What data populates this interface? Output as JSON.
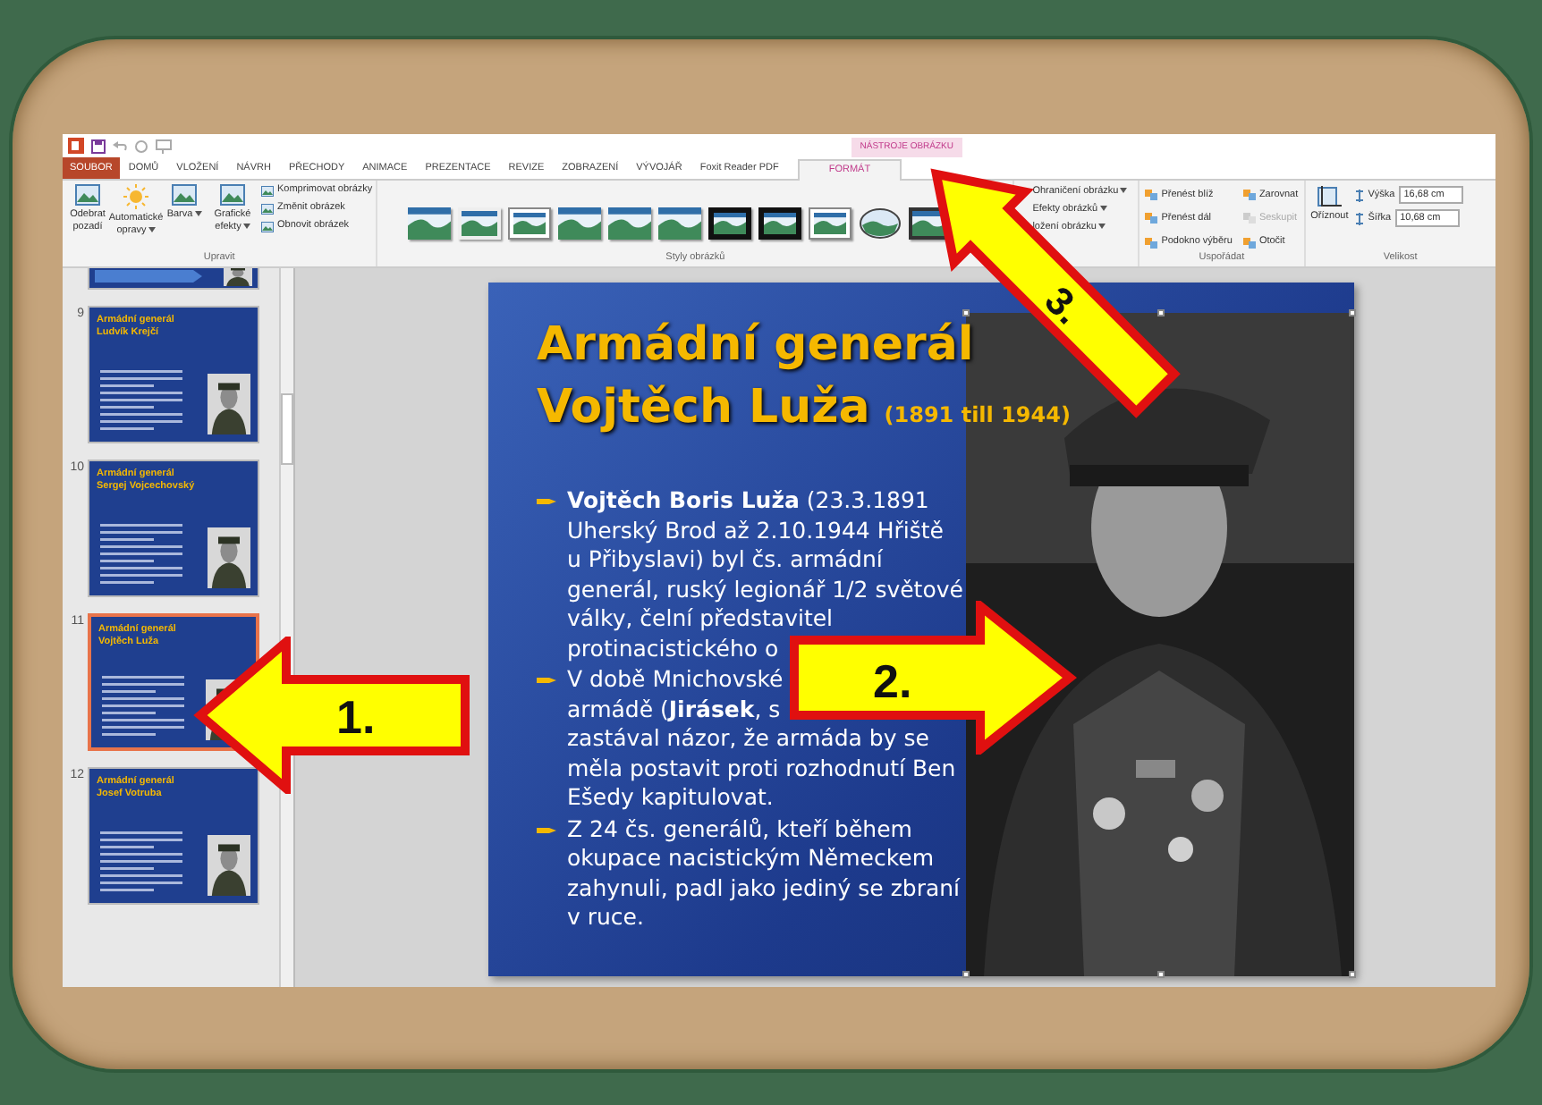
{
  "ribbon": {
    "context_label": "NÁSTROJE OBRÁZKU",
    "tabs": [
      {
        "label": "SOUBOR",
        "kind": "file",
        "selected": false
      },
      {
        "label": "DOMŮ",
        "kind": "tab",
        "selected": false
      },
      {
        "label": "VLOŽENÍ",
        "kind": "tab",
        "selected": false
      },
      {
        "label": "NÁVRH",
        "kind": "tab",
        "selected": false
      },
      {
        "label": "PŘECHODY",
        "kind": "tab",
        "selected": false
      },
      {
        "label": "ANIMACE",
        "kind": "tab",
        "selected": false
      },
      {
        "label": "PREZENTACE",
        "kind": "tab",
        "selected": false
      },
      {
        "label": "REVIZE",
        "kind": "tab",
        "selected": false
      },
      {
        "label": "ZOBRAZENÍ",
        "kind": "tab",
        "selected": false
      },
      {
        "label": "VÝVOJÁŘ",
        "kind": "tab",
        "selected": false
      },
      {
        "label": "Foxit Reader PDF",
        "kind": "tab",
        "selected": false
      },
      {
        "label": "FORMÁT",
        "kind": "context",
        "selected": true
      }
    ],
    "adjust_group": {
      "title": "Upravit",
      "large_buttons": [
        "Odebrat pozadí",
        "Automatické opravy",
        "Barva",
        "Grafické efekty"
      ],
      "small_buttons": [
        "Komprimovat obrázky",
        "Změnit obrázek",
        "Obnovit obrázek"
      ]
    },
    "styles_group": {
      "title": "Styly obrázků",
      "styles": [
        {
          "kind": "plain"
        },
        {
          "kind": "soft"
        },
        {
          "kind": "frame"
        },
        {
          "kind": "plain"
        },
        {
          "kind": "plain"
        },
        {
          "kind": "plain"
        },
        {
          "kind": "black"
        },
        {
          "kind": "black"
        },
        {
          "kind": "frame"
        },
        {
          "kind": "oval"
        },
        {
          "kind": "dark"
        }
      ]
    },
    "picture_group": [
      "Ohraničení obrázku",
      "Efekty obrázků",
      "ložení obrázku"
    ],
    "arrange_group": {
      "title": "Uspořádat",
      "buttons": [
        {
          "label": "Přenést blíž",
          "disabled": false
        },
        {
          "label": "Přenést dál",
          "disabled": false
        },
        {
          "label": "Podokno výběru",
          "disabled": false
        },
        {
          "label": "Zarovnat",
          "disabled": false
        },
        {
          "label": "Seskupit",
          "disabled": true
        },
        {
          "label": "Otočit",
          "disabled": false
        }
      ]
    },
    "size_group": {
      "title": "Velikost",
      "crop": "Oříznout",
      "fields": [
        {
          "label": "Výška",
          "value": "16,68 cm"
        },
        {
          "label": "Šířka",
          "value": "10,68 cm"
        }
      ]
    }
  },
  "thumbnails": [
    {
      "number": "9",
      "title": [
        "Armádní generál",
        "Ludvík Krejčí"
      ],
      "selected": false
    },
    {
      "number": "10",
      "title": [
        "Armádní generál",
        "Sergej Vojcechovský"
      ],
      "selected": false
    },
    {
      "number": "11",
      "title": [
        "Armádní generál",
        "Vojtěch Luža"
      ],
      "selected": true
    },
    {
      "number": "12",
      "title": [
        "Armádní generál",
        "Josef Votruba"
      ],
      "selected": false
    }
  ],
  "slide": {
    "title_lines": [
      "Armádní generál",
      "Vojtěch Luža"
    ],
    "years": "(1891 till 1944)",
    "bullets": [
      [
        "**Vojtěch Boris Luža** (23.3.1891",
        "Uherský Brod až 2.10.1944 Hřiště",
        "u Přibyslavi) byl čs. armádní",
        "generál, ruský legionář 1/2 světové",
        "války, čelní představitel",
        "protinacistického o"
      ],
      [
        "V době Mnichovské",
        "armádě (**Jirásek**, s",
        "zastával názor, že armáda by se",
        "měla postavit proti rozhodnutí Ben",
        "Ešedy kapitulovat."
      ],
      [
        "Z 24 čs. generálů, kteří během",
        "okupace nacistickým Německem",
        "zahynuli, padl jako jediný se zbraní",
        "v ruce."
      ]
    ]
  },
  "callouts": [
    {
      "label": "1.",
      "kind": "left"
    },
    {
      "label": "2.",
      "kind": "right"
    },
    {
      "label": "3.",
      "kind": "up-left"
    }
  ]
}
